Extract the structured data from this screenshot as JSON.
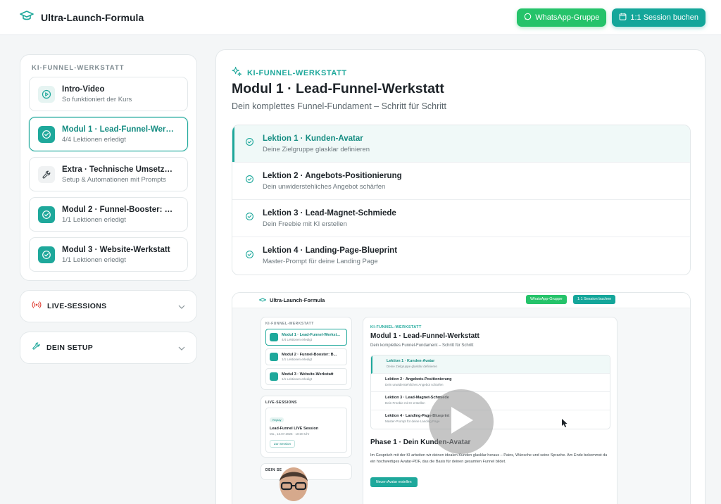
{
  "header": {
    "brand": "Ultra-Launch-Formula",
    "whatsapp_label": "WhatsApp-Gruppe",
    "session_label": "1:1 Session buchen",
    "brand_icon": "graduation-cap-icon",
    "accent_color": "#1ea89b",
    "whatsapp_color": "#25c36a"
  },
  "sidebar": {
    "course_title": "KI-FUNNEL-WERKSTATT",
    "items": [
      {
        "title": "Intro-Video",
        "subtitle": "So funktioniert der Kurs",
        "icon": "play-circle-icon",
        "active": false
      },
      {
        "title": "Modul 1 · Lead-Funnel-Werkstatt",
        "subtitle": "4/4 Lektionen erledigt",
        "icon": "check-circle-icon",
        "active": true
      },
      {
        "title": "Extra · Technische Umsetzung",
        "subtitle": "Setup & Automationen mit Prompts",
        "icon": "wrench-icon",
        "active": false
      },
      {
        "title": "Modul 2 · Funnel-Booster: Bonus",
        "subtitle": "1/1 Lektionen erledigt",
        "icon": "check-circle-icon",
        "active": false
      },
      {
        "title": "Modul 3 · Website-Werkstatt",
        "subtitle": "1/1 Lektionen erledigt",
        "icon": "check-circle-icon",
        "active": false
      }
    ],
    "live_sessions_label": "LIVE-SESSIONS",
    "setup_label": "DEIN SETUP"
  },
  "main": {
    "eyebrow": "KI-FUNNEL-WERKSTATT",
    "title": "Modul 1 · Lead-Funnel-Werkstatt",
    "subtitle": "Dein komplettes Funnel-Fundament – Schritt für Schritt",
    "lessons": [
      {
        "title": "Lektion 1 · Kunden-Avatar",
        "subtitle": "Deine Zielgruppe glasklar definieren",
        "active": true
      },
      {
        "title": "Lektion 2 · Angebots-Positionierung",
        "subtitle": "Dein unwiderstehliches Angebot schärfen",
        "active": false
      },
      {
        "title": "Lektion 3 · Lead-Magnet-Schmiede",
        "subtitle": "Dein Freebie mit KI erstellen",
        "active": false
      },
      {
        "title": "Lektion 4 · Landing-Page-Blueprint",
        "subtitle": "Master-Prompt für deine Landing Page",
        "active": false
      }
    ]
  },
  "video": {
    "brand": "Ultra-Launch-Formula",
    "wa": "WhatsApp-Gruppe",
    "session": "1:1 Session buchen",
    "course_label": "KI-FUNNEL-WERKSTATT",
    "items": [
      {
        "title": "Modul 1 · Lead-Funnel-Werkst...",
        "sub": "4/4 Lektionen erledigt"
      },
      {
        "title": "Modul 2 · Funnel-Booster: B...",
        "sub": "1/1 Lektionen erledigt"
      },
      {
        "title": "Modul 3 · Website-Werkstatt",
        "sub": "1/1 Lektionen erledigt"
      }
    ],
    "live_label": "LIVE-SESSIONS",
    "live_badge": "Replay",
    "live_title": "Lead-Funnel LIVE Session",
    "live_date": "Mo., 13.07.2026 · 10:30 Uhr",
    "live_btn": "Zur Session",
    "setup_label": "DEIN SE",
    "eyebrow": "KI-FUNNEL-WERKSTATT",
    "title": "Modul 1 · Lead-Funnel-Werkstatt",
    "subtitle": "Dein komplettes Funnel-Fundament – Schritt für Schritt",
    "lessons": [
      {
        "title": "Lektion 1 · Kunden-Avatar",
        "sub": "Deine Zielgruppe glasklar definieren"
      },
      {
        "title": "Lektion 2 · Angebots-Positionierung",
        "sub": "Dein unwiderstehliches Angebot schärfen"
      },
      {
        "title": "Lektion 3 · Lead-Magnet-Schmiede",
        "sub": "Dein Freebie mit KI erstellen"
      },
      {
        "title": "Lektion 4 · Landing-Page-Blueprint",
        "sub": "Master-Prompt für deine Landing Page"
      }
    ],
    "phase": "Phase 1 · Dein Kunden-Avatar",
    "paragraph": "Im Gespräch mit der KI arbeiten wir deinen idealen Kunden glasklar heraus – Pains, Wünsche und seine Sprache. Am Ende bekommst du ein hochwertiges Avatar-PDF, das die Basis für deinen gesamten Funnel bildet.",
    "new_button": "Neuen Avatar erstellen"
  }
}
